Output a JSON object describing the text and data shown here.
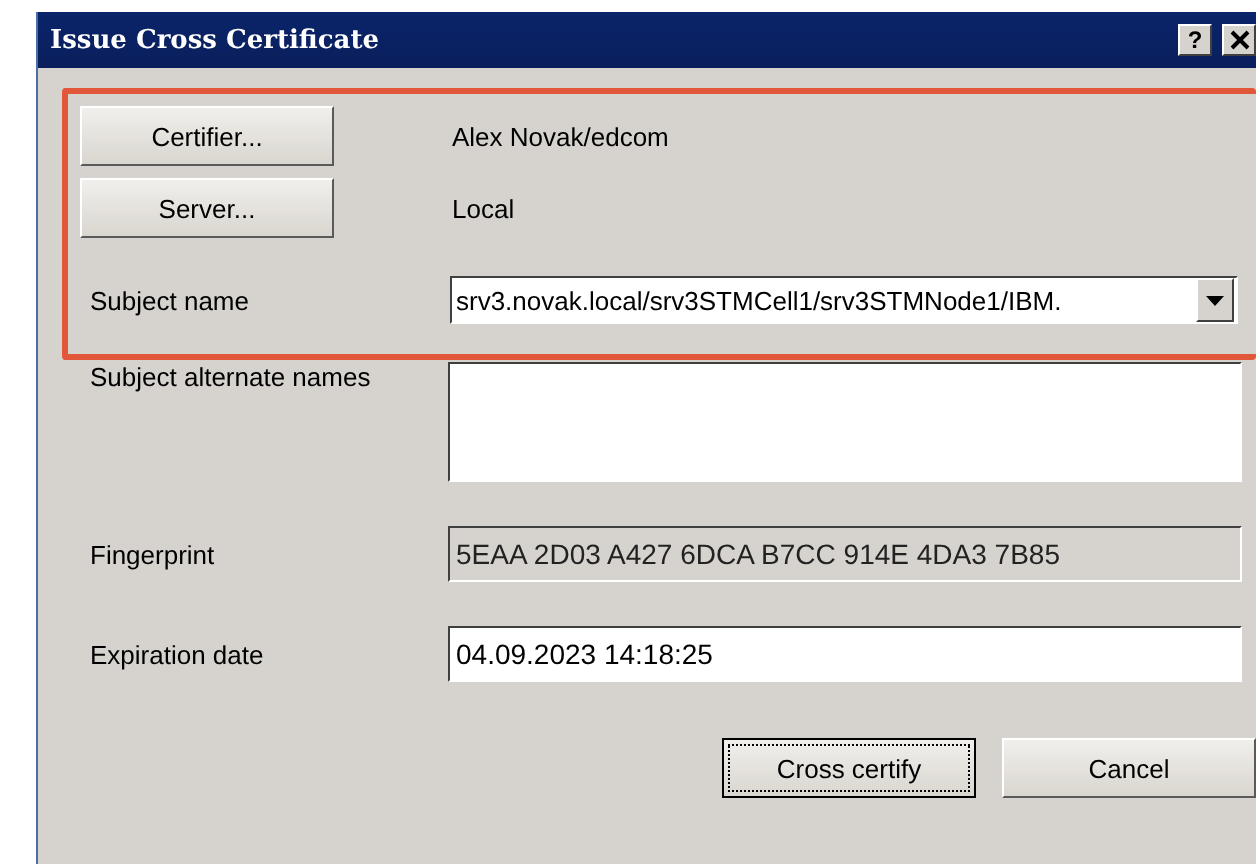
{
  "window": {
    "title": "Issue Cross Certificate",
    "help": "?"
  },
  "certifier": {
    "button": "Certifier...",
    "value": "Alex Novak/edcom"
  },
  "server": {
    "button": "Server...",
    "value": "Local"
  },
  "subject_name": {
    "label": "Subject name",
    "value": "srv3.novak.local/srv3STMCell1/srv3STMNode1/IBM."
  },
  "subject_alternate_names": {
    "label": "Subject alternate names"
  },
  "fingerprint": {
    "label": "Fingerprint",
    "value": "5EAA 2D03 A427 6DCA B7CC 914E 4DA3 7B85",
    "disabled": true
  },
  "expiration_date": {
    "label": "Expiration date",
    "value": "04.09.2023 14:18:25"
  },
  "buttons": [
    {
      "label": "Cross certify",
      "focused": true
    },
    {
      "label": "Cancel",
      "focused": false
    }
  ]
}
